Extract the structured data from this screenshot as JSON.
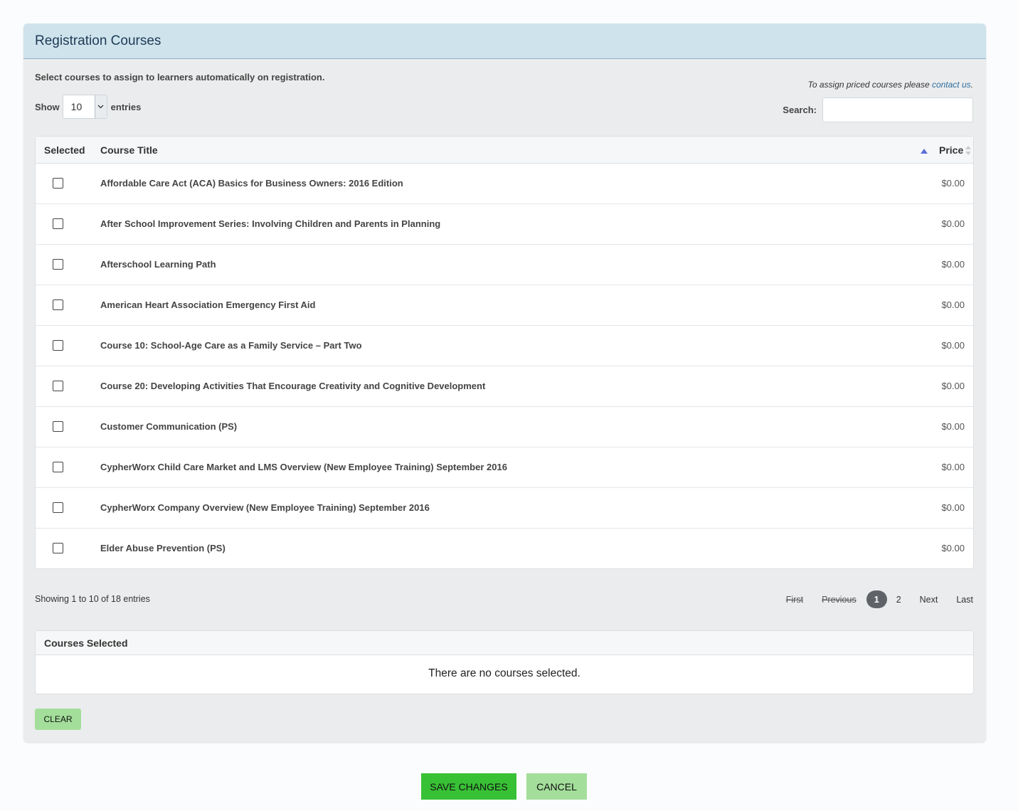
{
  "panel": {
    "title": "Registration Courses",
    "intro": "Select courses to assign to learners automatically on registration.",
    "priced_note_prefix": "To assign priced courses please ",
    "priced_note_link": "contact us",
    "priced_note_suffix": "."
  },
  "length": {
    "show_label": "Show",
    "value": "10",
    "entries_label": "entries"
  },
  "search": {
    "label": "Search:",
    "value": ""
  },
  "table": {
    "headers": {
      "selected": "Selected",
      "title": "Course Title",
      "price": "Price"
    },
    "sort": {
      "column": "Course Title",
      "direction": "ascending"
    },
    "rows": [
      {
        "title": "Affordable Care Act (ACA) Basics for Business Owners: 2016 Edition",
        "price": "$0.00",
        "selected": false
      },
      {
        "title": "After School Improvement Series: Involving Children and Parents in Planning",
        "price": "$0.00",
        "selected": false
      },
      {
        "title": "Afterschool Learning Path",
        "price": "$0.00",
        "selected": false
      },
      {
        "title": "American Heart Association Emergency First Aid",
        "price": "$0.00",
        "selected": false
      },
      {
        "title": "Course 10: School-Age Care as a Family Service – Part Two",
        "price": "$0.00",
        "selected": false
      },
      {
        "title": "Course 20: Developing Activities That Encourage Creativity and Cognitive Development",
        "price": "$0.00",
        "selected": false
      },
      {
        "title": "Customer Communication (PS)",
        "price": "$0.00",
        "selected": false
      },
      {
        "title": "CypherWorx Child Care Market and LMS Overview (New Employee Training) September 2016",
        "price": "$0.00",
        "selected": false
      },
      {
        "title": "CypherWorx Company Overview (New Employee Training) September 2016",
        "price": "$0.00",
        "selected": false
      },
      {
        "title": "Elder Abuse Prevention (PS)",
        "price": "$0.00",
        "selected": false
      }
    ]
  },
  "info": "Showing 1 to 10 of 18 entries",
  "pager": {
    "first": "First",
    "previous": "Previous",
    "page1": "1",
    "page2": "2",
    "next": "Next",
    "last": "Last"
  },
  "selected_courses": {
    "title": "Courses Selected",
    "empty": "There are no courses selected."
  },
  "buttons": {
    "clear": "CLEAR",
    "save": "SAVE CHANGES",
    "cancel": "CANCEL"
  },
  "colors": {
    "header_bg": "#cfe3ed",
    "link": "#2f6f9e",
    "save": "#38c135",
    "secondary": "#a3de9a",
    "sort_active": "#5b6fd6"
  }
}
